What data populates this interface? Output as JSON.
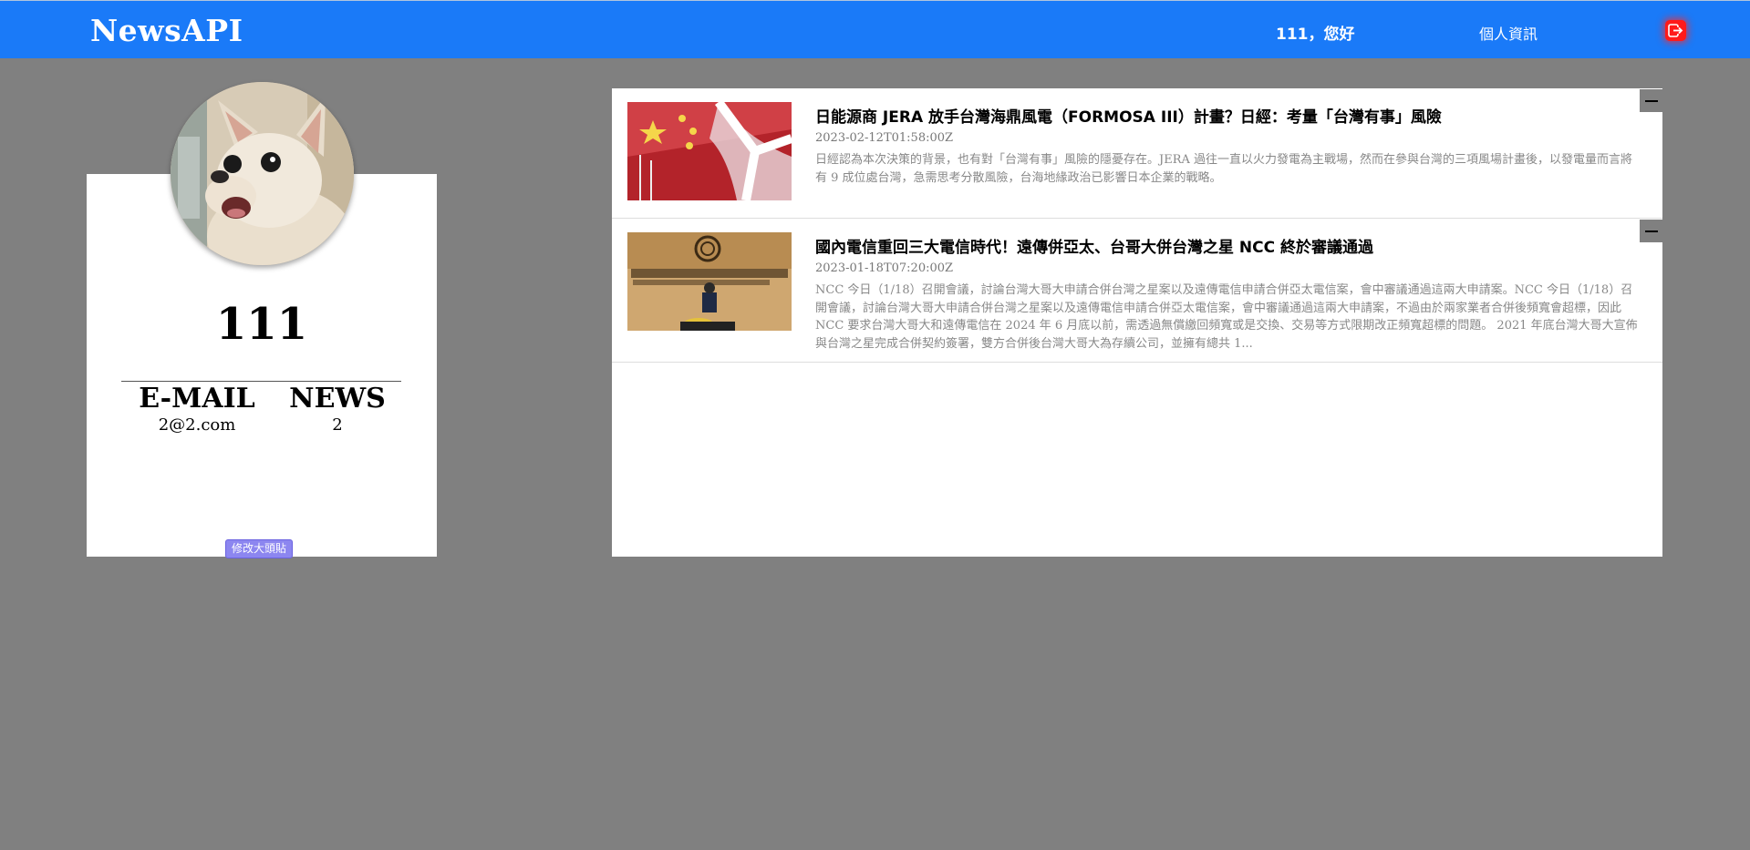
{
  "header": {
    "brand": "NewsAPI",
    "greeting": "111，您好",
    "profile_link": "個人資訊",
    "logout_icon": "logout-icon",
    "accent_color": "#1a7af8"
  },
  "profile": {
    "username": "111",
    "email_label": "E-MAIL",
    "email_value": "2@2.com",
    "news_label": "NEWS",
    "news_value": "2",
    "change_avatar_label": "修改大頭貼"
  },
  "news": [
    {
      "title": "日能源商 JERA 放手台灣海鼎風電（FORMOSA III）計畫？日經：考量「台灣有事」風險",
      "date": "2023-02-12T01:58:00Z",
      "description": "日經認為本次決策的背景，也有對「台灣有事」風險的隱憂存在。JERA 過往一直以火力發電為主戰場，然而在參與台灣的三項風場計畫後，以發電量而言將有 9 成位處台灣，急需思考分散風險，台海地緣政治已影響日本企業的戰略。"
    },
    {
      "title": "國內電信重回三大電信時代！遠傳併亞太、台哥大併台灣之星 NCC 終於審議通過",
      "date": "2023-01-18T07:20:00Z",
      "description": "NCC 今日（1/18）召開會議，討論台灣大哥大申請合併台灣之星案以及遠傳電信申請合併亞太電信案，會中審議通過這兩大申請案。NCC 今日（1/18）召開會議，討論台灣大哥大申請合併台灣之星案以及遠傳電信申請合併亞太電信案，會中審議通過這兩大申請案，不過由於兩家業者合併後頻寬會超標，因此 NCC 要求台灣大哥大和遠傳電信在 2024 年 6 月底以前，需透過無償繳回頻寬或是交換、交易等方式限期改正頻寬超標的問題。 2021 年底台灣大哥大宣佈與台灣之星完成合併契約簽署，雙方合併後台灣大哥大為存續公司，並擁有總共 1..."
    }
  ]
}
